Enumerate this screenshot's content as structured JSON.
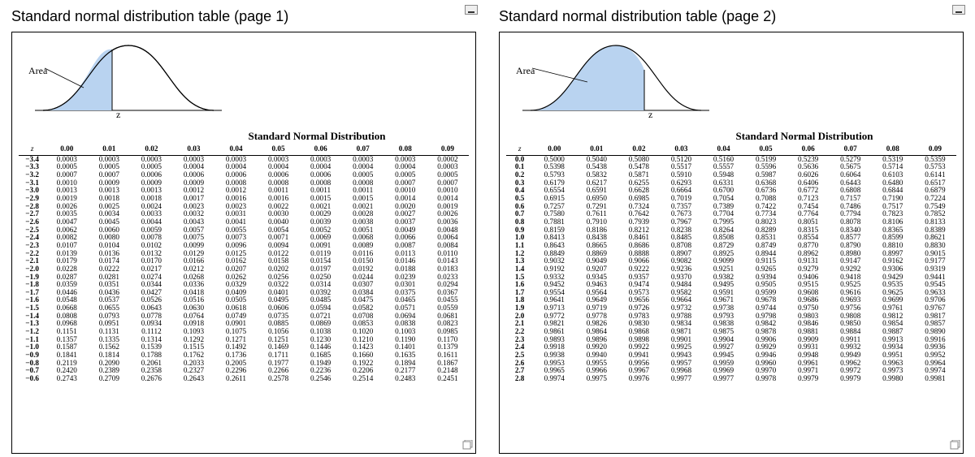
{
  "page1": {
    "title": "Standard normal distribution table (page 1)",
    "area_label": "Area",
    "z_label": "z",
    "table_caption": "Standard Normal Distribution",
    "col_headers": [
      "z",
      "0.00",
      "0.01",
      "0.02",
      "0.03",
      "0.04",
      "0.05",
      "0.06",
      "0.07",
      "0.08",
      "0.09"
    ],
    "rows": [
      [
        "−3.4",
        "0.0003",
        "0.0003",
        "0.0003",
        "0.0003",
        "0.0003",
        "0.0003",
        "0.0003",
        "0.0003",
        "0.0003",
        "0.0002"
      ],
      [
        "−3.3",
        "0.0005",
        "0.0005",
        "0.0005",
        "0.0004",
        "0.0004",
        "0.0004",
        "0.0004",
        "0.0004",
        "0.0004",
        "0.0003"
      ],
      [
        "−3.2",
        "0.0007",
        "0.0007",
        "0.0006",
        "0.0006",
        "0.0006",
        "0.0006",
        "0.0006",
        "0.0005",
        "0.0005",
        "0.0005"
      ],
      [
        "−3.1",
        "0.0010",
        "0.0009",
        "0.0009",
        "0.0009",
        "0.0008",
        "0.0008",
        "0.0008",
        "0.0008",
        "0.0007",
        "0.0007"
      ],
      [
        "−3.0",
        "0.0013",
        "0.0013",
        "0.0013",
        "0.0012",
        "0.0012",
        "0.0011",
        "0.0011",
        "0.0011",
        "0.0010",
        "0.0010"
      ],
      [
        "−2.9",
        "0.0019",
        "0.0018",
        "0.0018",
        "0.0017",
        "0.0016",
        "0.0016",
        "0.0015",
        "0.0015",
        "0.0014",
        "0.0014"
      ],
      [
        "−2.8",
        "0.0026",
        "0.0025",
        "0.0024",
        "0.0023",
        "0.0023",
        "0.0022",
        "0.0021",
        "0.0021",
        "0.0020",
        "0.0019"
      ],
      [
        "−2.7",
        "0.0035",
        "0.0034",
        "0.0033",
        "0.0032",
        "0.0031",
        "0.0030",
        "0.0029",
        "0.0028",
        "0.0027",
        "0.0026"
      ],
      [
        "−2.6",
        "0.0047",
        "0.0045",
        "0.0044",
        "0.0043",
        "0.0041",
        "0.0040",
        "0.0039",
        "0.0038",
        "0.0037",
        "0.0036"
      ],
      [
        "−2.5",
        "0.0062",
        "0.0060",
        "0.0059",
        "0.0057",
        "0.0055",
        "0.0054",
        "0.0052",
        "0.0051",
        "0.0049",
        "0.0048"
      ],
      [
        "−2.4",
        "0.0082",
        "0.0080",
        "0.0078",
        "0.0075",
        "0.0073",
        "0.0071",
        "0.0069",
        "0.0068",
        "0.0066",
        "0.0064"
      ],
      [
        "−2.3",
        "0.0107",
        "0.0104",
        "0.0102",
        "0.0099",
        "0.0096",
        "0.0094",
        "0.0091",
        "0.0089",
        "0.0087",
        "0.0084"
      ],
      [
        "−2.2",
        "0.0139",
        "0.0136",
        "0.0132",
        "0.0129",
        "0.0125",
        "0.0122",
        "0.0119",
        "0.0116",
        "0.0113",
        "0.0110"
      ],
      [
        "−2.1",
        "0.0179",
        "0.0174",
        "0.0170",
        "0.0166",
        "0.0162",
        "0.0158",
        "0.0154",
        "0.0150",
        "0.0146",
        "0.0143"
      ],
      [
        "−2.0",
        "0.0228",
        "0.0222",
        "0.0217",
        "0.0212",
        "0.0207",
        "0.0202",
        "0.0197",
        "0.0192",
        "0.0188",
        "0.0183"
      ],
      [
        "−1.9",
        "0.0287",
        "0.0281",
        "0.0274",
        "0.0268",
        "0.0262",
        "0.0256",
        "0.0250",
        "0.0244",
        "0.0239",
        "0.0233"
      ],
      [
        "−1.8",
        "0.0359",
        "0.0351",
        "0.0344",
        "0.0336",
        "0.0329",
        "0.0322",
        "0.0314",
        "0.0307",
        "0.0301",
        "0.0294"
      ],
      [
        "−1.7",
        "0.0446",
        "0.0436",
        "0.0427",
        "0.0418",
        "0.0409",
        "0.0401",
        "0.0392",
        "0.0384",
        "0.0375",
        "0.0367"
      ],
      [
        "−1.6",
        "0.0548",
        "0.0537",
        "0.0526",
        "0.0516",
        "0.0505",
        "0.0495",
        "0.0485",
        "0.0475",
        "0.0465",
        "0.0455"
      ],
      [
        "−1.5",
        "0.0668",
        "0.0655",
        "0.0643",
        "0.0630",
        "0.0618",
        "0.0606",
        "0.0594",
        "0.0582",
        "0.0571",
        "0.0559"
      ],
      [
        "−1.4",
        "0.0808",
        "0.0793",
        "0.0778",
        "0.0764",
        "0.0749",
        "0.0735",
        "0.0721",
        "0.0708",
        "0.0694",
        "0.0681"
      ],
      [
        "−1.3",
        "0.0968",
        "0.0951",
        "0.0934",
        "0.0918",
        "0.0901",
        "0.0885",
        "0.0869",
        "0.0853",
        "0.0838",
        "0.0823"
      ],
      [
        "−1.2",
        "0.1151",
        "0.1131",
        "0.1112",
        "0.1093",
        "0.1075",
        "0.1056",
        "0.1038",
        "0.1020",
        "0.1003",
        "0.0985"
      ],
      [
        "−1.1",
        "0.1357",
        "0.1335",
        "0.1314",
        "0.1292",
        "0.1271",
        "0.1251",
        "0.1230",
        "0.1210",
        "0.1190",
        "0.1170"
      ],
      [
        "−1.0",
        "0.1587",
        "0.1562",
        "0.1539",
        "0.1515",
        "0.1492",
        "0.1469",
        "0.1446",
        "0.1423",
        "0.1401",
        "0.1379"
      ],
      [
        "−0.9",
        "0.1841",
        "0.1814",
        "0.1788",
        "0.1762",
        "0.1736",
        "0.1711",
        "0.1685",
        "0.1660",
        "0.1635",
        "0.1611"
      ],
      [
        "−0.8",
        "0.2119",
        "0.2090",
        "0.2061",
        "0.2033",
        "0.2005",
        "0.1977",
        "0.1949",
        "0.1922",
        "0.1894",
        "0.1867"
      ],
      [
        "−0.7",
        "0.2420",
        "0.2389",
        "0.2358",
        "0.2327",
        "0.2296",
        "0.2266",
        "0.2236",
        "0.2206",
        "0.2177",
        "0.2148"
      ],
      [
        "−0.6",
        "0.2743",
        "0.2709",
        "0.2676",
        "0.2643",
        "0.2611",
        "0.2578",
        "0.2546",
        "0.2514",
        "0.2483",
        "0.2451"
      ]
    ]
  },
  "page2": {
    "title": "Standard normal distribution table (page 2)",
    "area_label": "Area",
    "z_label": "z",
    "table_caption": "Standard Normal Distribution",
    "col_headers": [
      "z",
      "0.00",
      "0.01",
      "0.02",
      "0.03",
      "0.04",
      "0.05",
      "0.06",
      "0.07",
      "0.08",
      "0.09"
    ],
    "rows": [
      [
        "0.0",
        "0.5000",
        "0.5040",
        "0.5080",
        "0.5120",
        "0.5160",
        "0.5199",
        "0.5239",
        "0.5279",
        "0.5319",
        "0.5359"
      ],
      [
        "0.1",
        "0.5398",
        "0.5438",
        "0.5478",
        "0.5517",
        "0.5557",
        "0.5596",
        "0.5636",
        "0.5675",
        "0.5714",
        "0.5753"
      ],
      [
        "0.2",
        "0.5793",
        "0.5832",
        "0.5871",
        "0.5910",
        "0.5948",
        "0.5987",
        "0.6026",
        "0.6064",
        "0.6103",
        "0.6141"
      ],
      [
        "0.3",
        "0.6179",
        "0.6217",
        "0.6255",
        "0.6293",
        "0.6331",
        "0.6368",
        "0.6406",
        "0.6443",
        "0.6480",
        "0.6517"
      ],
      [
        "0.4",
        "0.6554",
        "0.6591",
        "0.6628",
        "0.6664",
        "0.6700",
        "0.6736",
        "0.6772",
        "0.6808",
        "0.6844",
        "0.6879"
      ],
      [
        "0.5",
        "0.6915",
        "0.6950",
        "0.6985",
        "0.7019",
        "0.7054",
        "0.7088",
        "0.7123",
        "0.7157",
        "0.7190",
        "0.7224"
      ],
      [
        "0.6",
        "0.7257",
        "0.7291",
        "0.7324",
        "0.7357",
        "0.7389",
        "0.7422",
        "0.7454",
        "0.7486",
        "0.7517",
        "0.7549"
      ],
      [
        "0.7",
        "0.7580",
        "0.7611",
        "0.7642",
        "0.7673",
        "0.7704",
        "0.7734",
        "0.7764",
        "0.7794",
        "0.7823",
        "0.7852"
      ],
      [
        "0.8",
        "0.7881",
        "0.7910",
        "0.7939",
        "0.7967",
        "0.7995",
        "0.8023",
        "0.8051",
        "0.8078",
        "0.8106",
        "0.8133"
      ],
      [
        "0.9",
        "0.8159",
        "0.8186",
        "0.8212",
        "0.8238",
        "0.8264",
        "0.8289",
        "0.8315",
        "0.8340",
        "0.8365",
        "0.8389"
      ],
      [
        "1.0",
        "0.8413",
        "0.8438",
        "0.8461",
        "0.8485",
        "0.8508",
        "0.8531",
        "0.8554",
        "0.8577",
        "0.8599",
        "0.8621"
      ],
      [
        "1.1",
        "0.8643",
        "0.8665",
        "0.8686",
        "0.8708",
        "0.8729",
        "0.8749",
        "0.8770",
        "0.8790",
        "0.8810",
        "0.8830"
      ],
      [
        "1.2",
        "0.8849",
        "0.8869",
        "0.8888",
        "0.8907",
        "0.8925",
        "0.8944",
        "0.8962",
        "0.8980",
        "0.8997",
        "0.9015"
      ],
      [
        "1.3",
        "0.9032",
        "0.9049",
        "0.9066",
        "0.9082",
        "0.9099",
        "0.9115",
        "0.9131",
        "0.9147",
        "0.9162",
        "0.9177"
      ],
      [
        "1.4",
        "0.9192",
        "0.9207",
        "0.9222",
        "0.9236",
        "0.9251",
        "0.9265",
        "0.9279",
        "0.9292",
        "0.9306",
        "0.9319"
      ],
      [
        "1.5",
        "0.9332",
        "0.9345",
        "0.9357",
        "0.9370",
        "0.9382",
        "0.9394",
        "0.9406",
        "0.9418",
        "0.9429",
        "0.9441"
      ],
      [
        "1.6",
        "0.9452",
        "0.9463",
        "0.9474",
        "0.9484",
        "0.9495",
        "0.9505",
        "0.9515",
        "0.9525",
        "0.9535",
        "0.9545"
      ],
      [
        "1.7",
        "0.9554",
        "0.9564",
        "0.9573",
        "0.9582",
        "0.9591",
        "0.9599",
        "0.9608",
        "0.9616",
        "0.9625",
        "0.9633"
      ],
      [
        "1.8",
        "0.9641",
        "0.9649",
        "0.9656",
        "0.9664",
        "0.9671",
        "0.9678",
        "0.9686",
        "0.9693",
        "0.9699",
        "0.9706"
      ],
      [
        "1.9",
        "0.9713",
        "0.9719",
        "0.9726",
        "0.9732",
        "0.9738",
        "0.9744",
        "0.9750",
        "0.9756",
        "0.9761",
        "0.9767"
      ],
      [
        "2.0",
        "0.9772",
        "0.9778",
        "0.9783",
        "0.9788",
        "0.9793",
        "0.9798",
        "0.9803",
        "0.9808",
        "0.9812",
        "0.9817"
      ],
      [
        "2.1",
        "0.9821",
        "0.9826",
        "0.9830",
        "0.9834",
        "0.9838",
        "0.9842",
        "0.9846",
        "0.9850",
        "0.9854",
        "0.9857"
      ],
      [
        "2.2",
        "0.9861",
        "0.9864",
        "0.9868",
        "0.9871",
        "0.9875",
        "0.9878",
        "0.9881",
        "0.9884",
        "0.9887",
        "0.9890"
      ],
      [
        "2.3",
        "0.9893",
        "0.9896",
        "0.9898",
        "0.9901",
        "0.9904",
        "0.9906",
        "0.9909",
        "0.9911",
        "0.9913",
        "0.9916"
      ],
      [
        "2.4",
        "0.9918",
        "0.9920",
        "0.9922",
        "0.9925",
        "0.9927",
        "0.9929",
        "0.9931",
        "0.9932",
        "0.9934",
        "0.9936"
      ],
      [
        "2.5",
        "0.9938",
        "0.9940",
        "0.9941",
        "0.9943",
        "0.9945",
        "0.9946",
        "0.9948",
        "0.9949",
        "0.9951",
        "0.9952"
      ],
      [
        "2.6",
        "0.9953",
        "0.9955",
        "0.9956",
        "0.9957",
        "0.9959",
        "0.9960",
        "0.9961",
        "0.9962",
        "0.9963",
        "0.9964"
      ],
      [
        "2.7",
        "0.9965",
        "0.9966",
        "0.9967",
        "0.9968",
        "0.9969",
        "0.9970",
        "0.9971",
        "0.9972",
        "0.9973",
        "0.9974"
      ],
      [
        "2.8",
        "0.9974",
        "0.9975",
        "0.9976",
        "0.9977",
        "0.9977",
        "0.9978",
        "0.9979",
        "0.9979",
        "0.9980",
        "0.9981"
      ]
    ]
  },
  "break_rows": [
    5,
    10,
    15,
    20,
    25
  ]
}
